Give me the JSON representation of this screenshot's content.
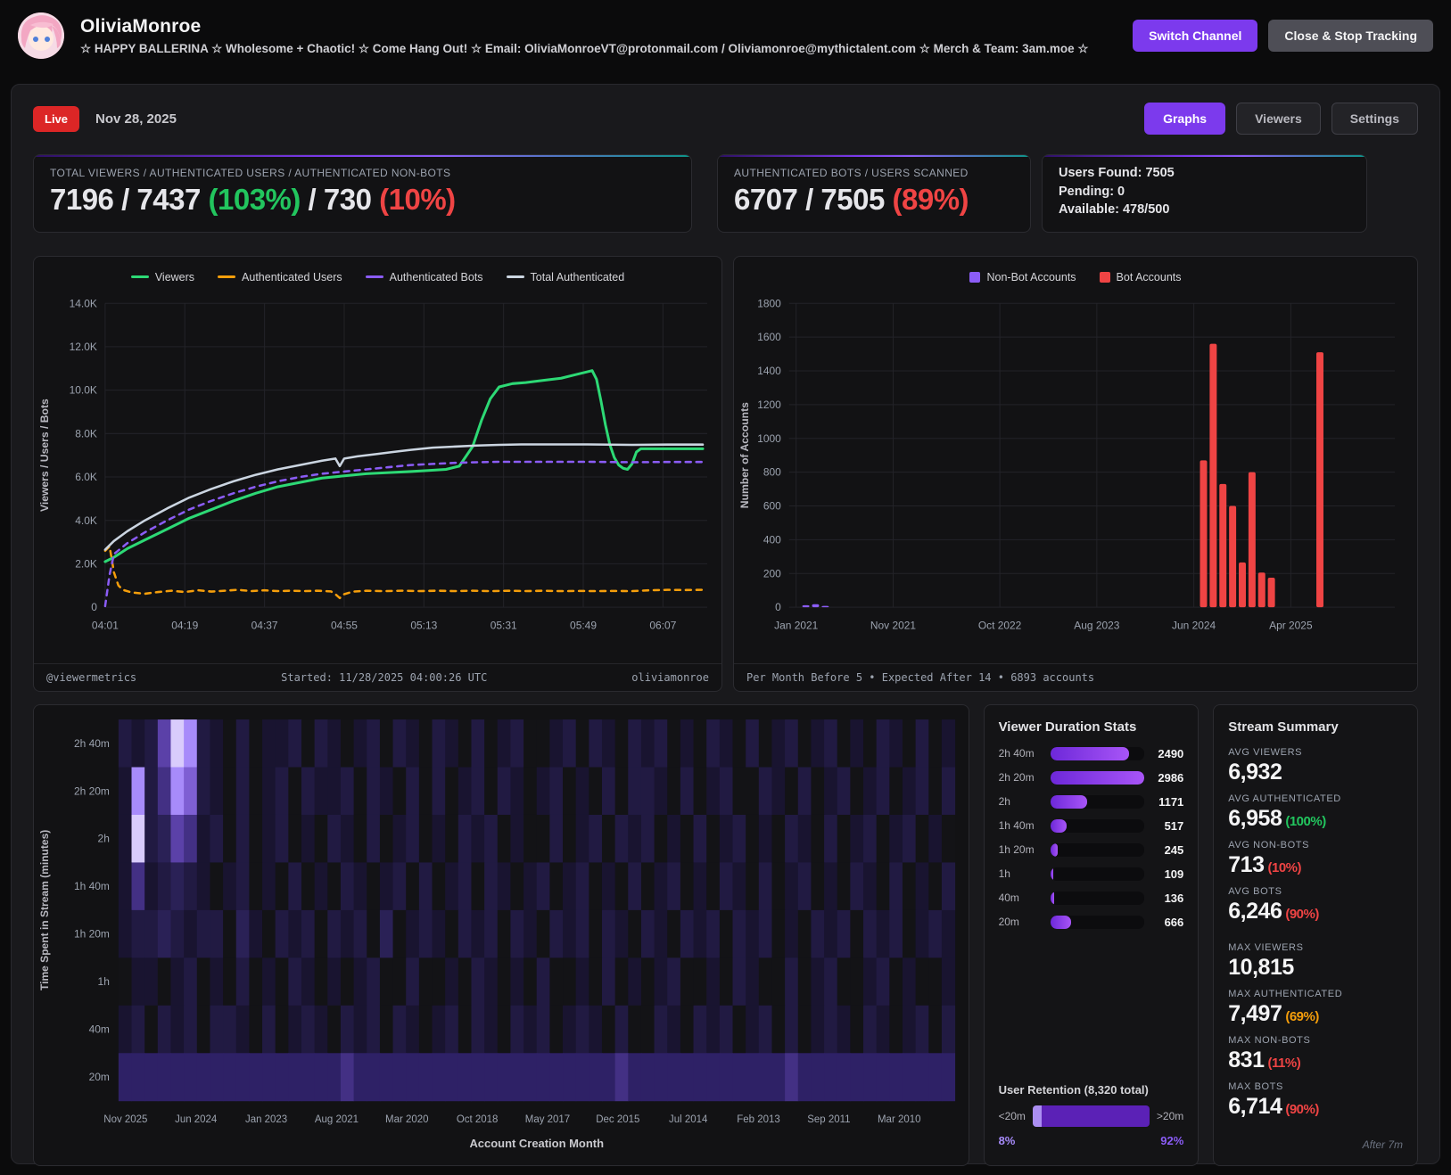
{
  "colors": {
    "accent": "#7c3aed",
    "live": "#dc2626",
    "green": "#22c55e",
    "red": "#ef4444",
    "orange": "#f59e0b",
    "grid": "#232328",
    "axis": "#9ca3af"
  },
  "header": {
    "title": "OliviaMonroe",
    "subtitle": "☆ HAPPY BALLERINA ☆ Wholesome + Chaotic! ☆ Come Hang Out! ☆ Email: OliviaMonroeVT@protonmail.com / Oliviamonroe@mythictalent.com ☆ Merch & Team: 3am.moe ☆",
    "switch_channel_label": "Switch Channel",
    "close_label": "Close & Stop Tracking"
  },
  "toolbar": {
    "live_label": "Live",
    "date": "Nov 28, 2025",
    "tabs": [
      {
        "label": "Graphs",
        "active": true
      },
      {
        "label": "Viewers",
        "active": false
      },
      {
        "label": "Settings",
        "active": false
      }
    ]
  },
  "stats": {
    "cards": [
      {
        "label": "TOTAL VIEWERS / AUTHENTICATED USERS / AUTHENTICATED NON-BOTS",
        "segments": [
          {
            "text": "7196 / 7437 ",
            "color": "#e6e6ea"
          },
          {
            "text": "(103%)",
            "color": "#22c55e"
          },
          {
            "text": " / 730 ",
            "color": "#e6e6ea"
          },
          {
            "text": "(10%)",
            "color": "#ef4444"
          }
        ]
      },
      {
        "label": "AUTHENTICATED BOTS / USERS SCANNED",
        "segments": [
          {
            "text": "6707 / 7505 ",
            "color": "#e6e6ea"
          },
          {
            "text": "(89%)",
            "color": "#ef4444"
          }
        ]
      },
      {
        "lines": [
          "Users Found: 7505",
          "Pending: 0",
          "Available: 478/500"
        ]
      }
    ]
  },
  "line_footer": {
    "left": "@viewermetrics",
    "center": "Started: 11/28/2025 04:00:26 UTC",
    "right": "oliviamonroe"
  },
  "bar_footer": {
    "text": "Per Month Before 5 • Expected After 14 • 6893 accounts"
  },
  "chart_data": [
    {
      "type": "line",
      "ylabel": "Viewers / Users / Bots",
      "xdomain": [
        1,
        137
      ],
      "ydomain": [
        0,
        14000
      ],
      "yticks": [
        {
          "v": 0,
          "label": "0"
        },
        {
          "v": 2000,
          "label": "2.0K"
        },
        {
          "v": 4000,
          "label": "4.0K"
        },
        {
          "v": 6000,
          "label": "6.0K"
        },
        {
          "v": 8000,
          "label": "8.0K"
        },
        {
          "v": 10000,
          "label": "10.0K"
        },
        {
          "v": 12000,
          "label": "12.0K"
        },
        {
          "v": 14000,
          "label": "14.0K"
        }
      ],
      "xticks": [
        {
          "t": 1,
          "label": "04:01"
        },
        {
          "t": 19,
          "label": "04:19"
        },
        {
          "t": 37,
          "label": "04:37"
        },
        {
          "t": 55,
          "label": "04:55"
        },
        {
          "t": 73,
          "label": "05:13"
        },
        {
          "t": 91,
          "label": "05:31"
        },
        {
          "t": 109,
          "label": "05:49"
        },
        {
          "t": 127,
          "label": "06:07"
        }
      ],
      "series": [
        {
          "name": "Viewers",
          "color": "#2dd975",
          "width": 3,
          "points": [
            [
              1,
              2100
            ],
            [
              3,
              2300
            ],
            [
              6,
              2700
            ],
            [
              10,
              3100
            ],
            [
              15,
              3600
            ],
            [
              20,
              4100
            ],
            [
              25,
              4500
            ],
            [
              30,
              4900
            ],
            [
              35,
              5250
            ],
            [
              40,
              5550
            ],
            [
              45,
              5750
            ],
            [
              50,
              5950
            ],
            [
              55,
              6050
            ],
            [
              60,
              6150
            ],
            [
              65,
              6200
            ],
            [
              70,
              6250
            ],
            [
              74,
              6300
            ],
            [
              78,
              6350
            ],
            [
              81,
              6500
            ],
            [
              84,
              7400
            ],
            [
              86,
              8600
            ],
            [
              88,
              9600
            ],
            [
              90,
              10150
            ],
            [
              93,
              10300
            ],
            [
              96,
              10350
            ],
            [
              100,
              10450
            ],
            [
              104,
              10550
            ],
            [
              107,
              10700
            ],
            [
              110,
              10850
            ],
            [
              111,
              10900
            ],
            [
              112,
              10500
            ],
            [
              113,
              9500
            ],
            [
              114,
              8400
            ],
            [
              115,
              7500
            ],
            [
              116,
              6900
            ],
            [
              117,
              6550
            ],
            [
              118,
              6400
            ],
            [
              119,
              6350
            ],
            [
              120,
              6600
            ],
            [
              121,
              7150
            ],
            [
              122,
              7300
            ],
            [
              128,
              7300
            ],
            [
              136,
              7300
            ]
          ]
        },
        {
          "name": "Authenticated Users",
          "color": "#f59e0b",
          "width": 2.5,
          "dash": "6 6",
          "points": [
            [
              1,
              2600
            ],
            [
              2,
              2800
            ],
            [
              3,
              1600
            ],
            [
              4,
              1000
            ],
            [
              5,
              800
            ],
            [
              7,
              680
            ],
            [
              10,
              620
            ],
            [
              13,
              700
            ],
            [
              16,
              760
            ],
            [
              19,
              700
            ],
            [
              22,
              780
            ],
            [
              25,
              720
            ],
            [
              28,
              760
            ],
            [
              31,
              800
            ],
            [
              34,
              740
            ],
            [
              37,
              780
            ],
            [
              40,
              740
            ],
            [
              43,
              760
            ],
            [
              46,
              740
            ],
            [
              49,
              760
            ],
            [
              52,
              730
            ],
            [
              53,
              600
            ],
            [
              54,
              420
            ],
            [
              55,
              600
            ],
            [
              57,
              720
            ],
            [
              60,
              760
            ],
            [
              64,
              740
            ],
            [
              68,
              760
            ],
            [
              72,
              740
            ],
            [
              76,
              760
            ],
            [
              80,
              740
            ],
            [
              84,
              760
            ],
            [
              88,
              740
            ],
            [
              92,
              760
            ],
            [
              96,
              740
            ],
            [
              100,
              760
            ],
            [
              104,
              740
            ],
            [
              108,
              750
            ],
            [
              112,
              740
            ],
            [
              116,
              750
            ],
            [
              120,
              740
            ],
            [
              124,
              780
            ],
            [
              128,
              800
            ],
            [
              132,
              790
            ],
            [
              136,
              800
            ]
          ]
        },
        {
          "name": "Authenticated Bots",
          "color": "#8b5cf6",
          "width": 2.5,
          "dash": "6 6",
          "points": [
            [
              1,
              50
            ],
            [
              2,
              1500
            ],
            [
              3,
              2450
            ],
            [
              6,
              2950
            ],
            [
              10,
              3450
            ],
            [
              15,
              4000
            ],
            [
              20,
              4500
            ],
            [
              25,
              4900
            ],
            [
              30,
              5250
            ],
            [
              35,
              5550
            ],
            [
              40,
              5800
            ],
            [
              45,
              6000
            ],
            [
              50,
              6150
            ],
            [
              55,
              6250
            ],
            [
              60,
              6350
            ],
            [
              65,
              6450
            ],
            [
              70,
              6550
            ],
            [
              75,
              6600
            ],
            [
              80,
              6650
            ],
            [
              85,
              6680
            ],
            [
              90,
              6700
            ],
            [
              100,
              6700
            ],
            [
              110,
              6700
            ],
            [
              120,
              6680
            ],
            [
              128,
              6690
            ],
            [
              136,
              6690
            ]
          ]
        },
        {
          "name": "Total Authenticated",
          "color": "#cbd5e1",
          "width": 2.5,
          "points": [
            [
              1,
              2650
            ],
            [
              3,
              3050
            ],
            [
              6,
              3500
            ],
            [
              10,
              4000
            ],
            [
              15,
              4550
            ],
            [
              20,
              5050
            ],
            [
              25,
              5450
            ],
            [
              30,
              5800
            ],
            [
              35,
              6100
            ],
            [
              40,
              6350
            ],
            [
              45,
              6550
            ],
            [
              50,
              6750
            ],
            [
              53,
              6850
            ],
            [
              54,
              6500
            ],
            [
              55,
              6850
            ],
            [
              58,
              6950
            ],
            [
              62,
              7050
            ],
            [
              66,
              7150
            ],
            [
              70,
              7250
            ],
            [
              75,
              7350
            ],
            [
              80,
              7400
            ],
            [
              85,
              7450
            ],
            [
              90,
              7480
            ],
            [
              95,
              7500
            ],
            [
              100,
              7500
            ],
            [
              110,
              7500
            ],
            [
              120,
              7480
            ],
            [
              128,
              7490
            ],
            [
              136,
              7490
            ]
          ]
        }
      ]
    },
    {
      "type": "bar",
      "ylabel": "Number of Accounts",
      "xdomain": [
        0,
        61
      ],
      "ydomain": [
        0,
        1800
      ],
      "yticks": [
        {
          "v": 0,
          "label": "0"
        },
        {
          "v": 200,
          "label": "200"
        },
        {
          "v": 400,
          "label": "400"
        },
        {
          "v": 600,
          "label": "600"
        },
        {
          "v": 800,
          "label": "800"
        },
        {
          "v": 1000,
          "label": "1000"
        },
        {
          "v": 1200,
          "label": "1200"
        },
        {
          "v": 1400,
          "label": "1400"
        },
        {
          "v": 1600,
          "label": "1600"
        },
        {
          "v": 1800,
          "label": "1800"
        }
      ],
      "xticks": [
        {
          "t": 0,
          "label": "Jan 2021"
        },
        {
          "t": 10,
          "label": "Nov 2021"
        },
        {
          "t": 21,
          "label": "Oct 2022"
        },
        {
          "t": 31,
          "label": "Aug 2023"
        },
        {
          "t": 41,
          "label": "Jun 2024"
        },
        {
          "t": 51,
          "label": "Apr 2025"
        }
      ],
      "series": [
        {
          "name": "Non-Bot Accounts",
          "color": "#8b5cf6",
          "bars": [
            [
              1,
              12
            ],
            [
              2,
              18
            ],
            [
              3,
              8
            ]
          ]
        },
        {
          "name": "Bot Accounts",
          "color": "#ef4444",
          "bars": [
            [
              42,
              870
            ],
            [
              43,
              1560
            ],
            [
              44,
              730
            ],
            [
              45,
              600
            ],
            [
              46,
              265
            ],
            [
              47,
              800
            ],
            [
              48,
              205
            ],
            [
              49,
              175
            ],
            [
              54,
              1510
            ]
          ]
        }
      ]
    },
    {
      "type": "heatmap",
      "ylabel": "Time Spent in Stream (minutes)",
      "xlabel": "Account Creation Month",
      "row_labels": [
        "2h 40m",
        "2h 20m",
        "2h",
        "1h 40m",
        "1h 20m",
        "1h",
        "40m",
        "20m"
      ],
      "xticks": [
        "Nov 2025",
        "Jun 2024",
        "Jan 2023",
        "Aug 2021",
        "Mar 2020",
        "Oct 2018",
        "May 2017",
        "Dec 2015",
        "Jul 2014",
        "Feb 2013",
        "Sep 2011",
        "Mar 2010"
      ],
      "palette": {
        "0": "#131316",
        "1": "#191430",
        "2": "#211a42",
        "3": "#2a2156",
        "4": "#2e2166",
        "5": "#433084",
        "6": "#5b41a8",
        "7": "#7e5fd3",
        "8": "#a78bfa",
        "9": "#d9ccfc"
      },
      "rows": [
        "2126982102011202101202102102012001202102120102102012012010210201",
        "1825872102012021120210202012021012010202210201200210201201201202",
        "1923651202012010210201201021201002012021201020120102102012012010",
        "1512321012010201021012020120210120120102012010210201201021020102",
        "1223212203102120212030121021202102120210210212021201021202120121",
        "0110120102010210101200200102101020010201012001021002012001201001",
        "1202120221020121021202101202102120121020021021201202012102101202",
        "4444444444444444454444444444444444444454444444444445444444444444"
      ]
    }
  ],
  "duration": {
    "title": "Viewer Duration Stats",
    "rows": [
      {
        "label": "2h 40m",
        "value": 2490
      },
      {
        "label": "2h 20m",
        "value": 2986
      },
      {
        "label": "2h",
        "value": 1171
      },
      {
        "label": "1h 40m",
        "value": 517
      },
      {
        "label": "1h 20m",
        "value": 245
      },
      {
        "label": "1h",
        "value": 109
      },
      {
        "label": "40m",
        "value": 136
      },
      {
        "label": "20m",
        "value": 666
      }
    ]
  },
  "retention": {
    "title": "User Retention (8,320 total)",
    "left_label": "<20m",
    "right_label": ">20m",
    "left_pct": 8,
    "right_pct": 92,
    "left_pct_label": "8%",
    "right_pct_label": "92%",
    "left_color": "#a78bfa",
    "right_color": "#8b5cf6"
  },
  "summary": {
    "title": "Stream Summary",
    "note": "After 7m",
    "items": [
      {
        "label": "AVG VIEWERS",
        "value": "6,932",
        "percent": "",
        "percent_color": ""
      },
      {
        "label": "AVG AUTHENTICATED",
        "value": "6,958",
        "percent": "(100%)",
        "percent_color": "#22c55e"
      },
      {
        "label": "AVG NON-BOTS",
        "value": "713",
        "percent": "(10%)",
        "percent_color": "#ef4444"
      },
      {
        "label": "AVG BOTS",
        "value": "6,246",
        "percent": "(90%)",
        "percent_color": "#ef4444"
      },
      {
        "label": "MAX VIEWERS",
        "value": "10,815",
        "percent": "",
        "percent_color": "",
        "gap": true
      },
      {
        "label": "MAX AUTHENTICATED",
        "value": "7,497",
        "percent": "(69%)",
        "percent_color": "#f59e0b"
      },
      {
        "label": "MAX NON-BOTS",
        "value": "831",
        "percent": "(11%)",
        "percent_color": "#ef4444"
      },
      {
        "label": "MAX BOTS",
        "value": "6,714",
        "percent": "(90%)",
        "percent_color": "#ef4444"
      }
    ]
  }
}
